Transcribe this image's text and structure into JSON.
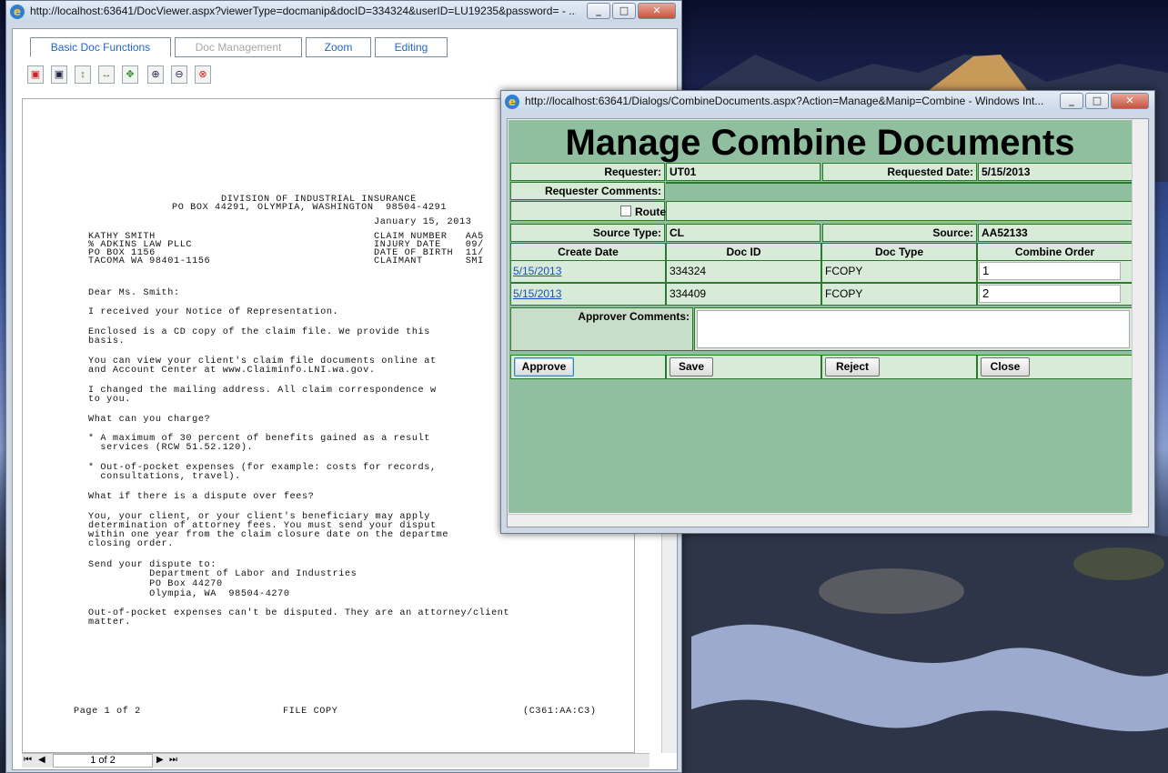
{
  "colors": {
    "panel_bg": "#8fbf9f",
    "cell_bg": "#d8ead8",
    "cell_border": "#2a7a2a",
    "link": "#1a4fc4",
    "tab_text": "#2266cc"
  },
  "viewer": {
    "url": "http://localhost:63641/DocViewer.aspx?viewerType=docmanip&docID=334324&userID=LU19235&password= - ...",
    "tabs": [
      "Basic Doc Functions",
      "Doc Management",
      "Zoom",
      "Editing"
    ],
    "toolbar_icons": [
      "fit-page-icon",
      "fit-width-icon",
      "move-vertical-icon",
      "move-horizontal-icon",
      "pan-icon",
      "zoom-in-icon",
      "zoom-out-icon",
      "zoom-reset-icon"
    ],
    "page_indicator": "1 of 2",
    "document": {
      "lines": [
        "DIVISION OF INDUSTRIAL INSURANCE",
        "PO BOX 44291, OLYMPIA, WASHINGTON  98504-4291",
        "January 15, 2013",
        "KATHY SMITH",
        "% ADKINS LAW PLLC",
        "PO BOX 1156",
        "TACOMA WA 98401-1156",
        "CLAIM NUMBER   AA5",
        "INJURY DATE    09/",
        "DATE OF BIRTH  11/",
        "CLAIMANT       SMI",
        "Dear Ms. Smith:",
        "I received your Notice of Representation.",
        "Enclosed is a CD copy of the claim file. We provide this",
        "basis.",
        "You can view your client's claim file documents online at",
        "and Account Center at www.Claiminfo.LNI.wa.gov.",
        "I changed the mailing address. All claim correspondence w",
        "to you.",
        "What can you charge?",
        "* A maximum of 30 percent of benefits gained as a result",
        "  services (RCW 51.52.120).",
        "* Out-of-pocket expenses (for example: costs for records,",
        "  consultations, travel).",
        "What if there is a dispute over fees?",
        "You, your client, or your client's beneficiary may apply",
        "determination of attorney fees. You must send your disput",
        "within one year from the claim closure date on the departme",
        "closing order.",
        "Send your dispute to:",
        "          Department of Labor and Industries",
        "          PO Box 44270",
        "          Olympia, WA  98504-4270",
        "Out-of-pocket expenses can't be disputed. They are an attorney/client",
        "matter."
      ],
      "footer_left": "Page 1 of 2",
      "footer_mid": "FILE COPY",
      "footer_right": "(C361:AA:C3)"
    }
  },
  "dialog": {
    "url": "http://localhost:63641/Dialogs/CombineDocuments.aspx?Action=Manage&Manip=Combine - Windows Int...",
    "heading": "Manage Combine Documents",
    "requester_label": "Requester:",
    "requester_value": "UT01",
    "requested_date_label": "Requested Date:",
    "requested_date_value": "5/15/2013",
    "requester_comments_label": "Requester Comments:",
    "route_label": "Route",
    "source_type_label": "Source Type:",
    "source_type_value": "CL",
    "source_label": "Source:",
    "source_value": "AA52133",
    "columns": [
      "Create Date",
      "Doc ID",
      "Doc Type",
      "Combine Order"
    ],
    "rows": [
      {
        "date": "5/15/2013",
        "doc_id": "334324",
        "doc_type": "FCOPY",
        "order": "1"
      },
      {
        "date": "5/15/2013",
        "doc_id": "334409",
        "doc_type": "FCOPY",
        "order": "2"
      }
    ],
    "approver_comments_label": "Approver Comments:",
    "buttons": {
      "approve": "Approve",
      "save": "Save",
      "reject": "Reject",
      "close": "Close"
    }
  }
}
